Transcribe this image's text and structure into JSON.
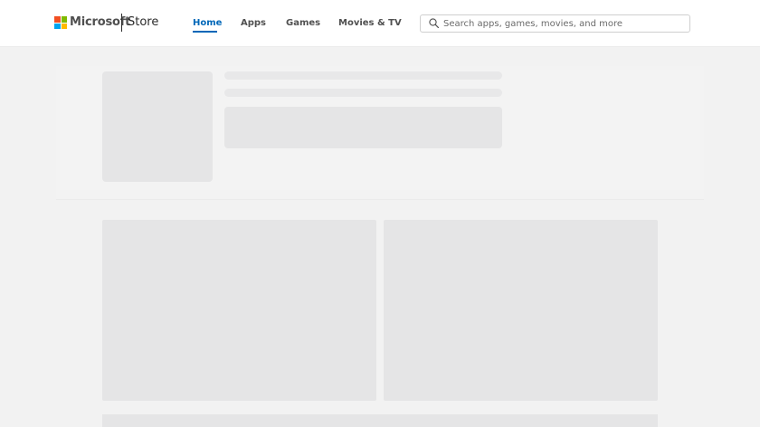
{
  "header": {
    "brand": "Microsoft",
    "store": "Store",
    "nav": [
      {
        "label": "Home",
        "active": true
      },
      {
        "label": "Apps",
        "active": false
      },
      {
        "label": "Games",
        "active": false
      },
      {
        "label": "Movies & TV",
        "active": false
      }
    ],
    "search": {
      "placeholder": "Search apps, games, movies, and more",
      "value": ""
    }
  },
  "colors": {
    "accent": "#0067b8",
    "background": "#f2f2f2",
    "skeleton": "#e5e5e6",
    "logo": [
      "#f25022",
      "#7fba00",
      "#00a4ef",
      "#ffb900"
    ]
  },
  "icons": {
    "logo": "microsoft-logo-icon",
    "search": "search-icon"
  }
}
